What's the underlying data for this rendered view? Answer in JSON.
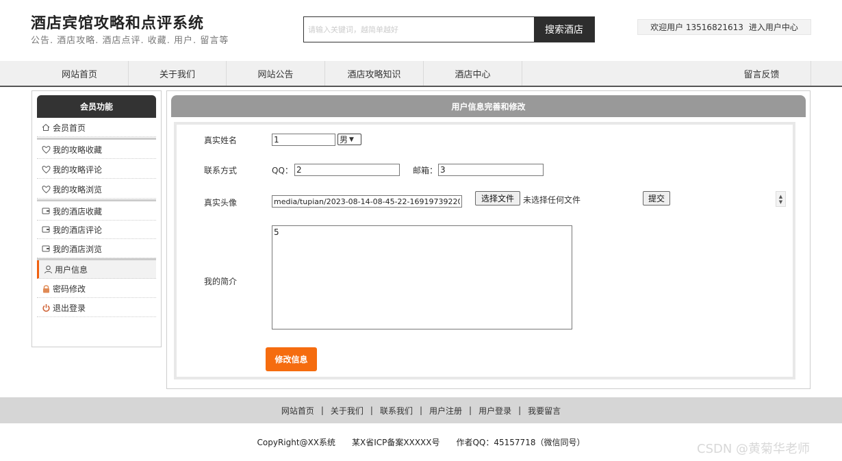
{
  "header": {
    "title": "酒店宾馆攻略和点评系统",
    "subtitle": "公告. 酒店攻略. 酒店点评. 收藏. 用户. 留言等",
    "search_placeholder": "请输入关键词，越简单越好",
    "search_button": "搜索酒店",
    "welcome_text": "欢迎用户 13516821613",
    "user_center_link": "进入用户中心"
  },
  "nav": {
    "items": [
      {
        "label": "网站首页"
      },
      {
        "label": "关于我们"
      },
      {
        "label": "网站公告"
      },
      {
        "label": "酒店攻略知识"
      },
      {
        "label": "酒店中心"
      },
      {
        "label": "留言反馈"
      }
    ]
  },
  "sidebar": {
    "title": "会员功能",
    "items": [
      {
        "label": "会员首页",
        "icon": "home-icon"
      },
      {
        "label": "我的攻略收藏",
        "icon": "heart-icon"
      },
      {
        "label": "我的攻略评论",
        "icon": "heart-icon"
      },
      {
        "label": "我的攻略浏览",
        "icon": "heart-icon"
      },
      {
        "label": "我的酒店收藏",
        "icon": "wallet-icon"
      },
      {
        "label": "我的酒店评论",
        "icon": "wallet-icon"
      },
      {
        "label": "我的酒店浏览",
        "icon": "wallet-icon"
      },
      {
        "label": "用户信息",
        "icon": "user-icon"
      },
      {
        "label": "密码修改",
        "icon": "lock-icon"
      },
      {
        "label": "退出登录",
        "icon": "power-icon"
      }
    ],
    "accent_color": "#f06010"
  },
  "form": {
    "heading": "用户信息完善和修改",
    "realname_label": "真实姓名",
    "realname_value": "1",
    "gender_value": "男",
    "contact_label": "联系方式",
    "qq_label": "QQ：",
    "qq_value": "2",
    "email_label": "邮箱：",
    "email_value": "3",
    "avatar_label": "真实头像",
    "avatar_path": "media/tupian/2023-08-14-08-45-22-16919739220",
    "choose_file_button": "选择文件",
    "no_file_text": "未选择任何文件",
    "upload_submit_button": "提交",
    "intro_label": "我的简介",
    "intro_value": "5",
    "save_button": "修改信息",
    "save_color": "#f56c0f"
  },
  "footer": {
    "links": [
      "网站首页",
      "关于我们",
      "联系我们",
      "用户注册",
      "用户登录",
      "我要留言"
    ],
    "separator": "|",
    "copyright": "CopyRight@XX系统　　某X省ICP备案XXXXX号　　作者QQ：45157718（微信同号）",
    "watermark": "CSDN @黄菊华老师"
  }
}
